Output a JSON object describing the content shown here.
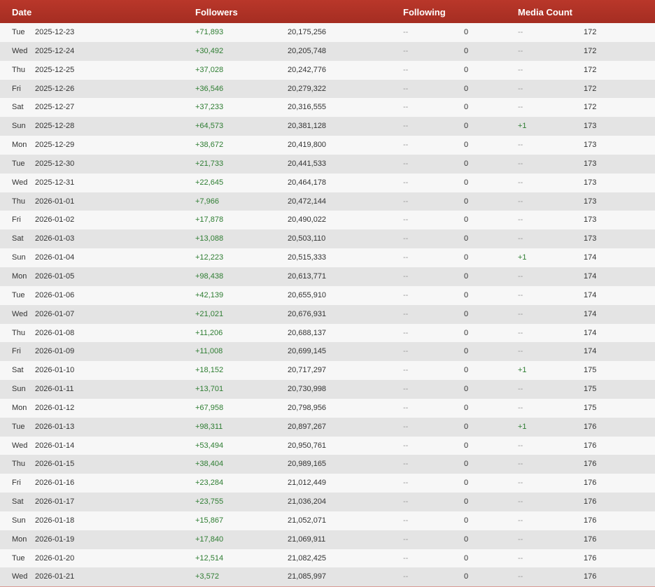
{
  "header": {
    "date": "Date",
    "followers": "Followers",
    "following": "Following",
    "media_count": "Media Count"
  },
  "colors": {
    "header_bg": "#b0321f",
    "positive": "#2e7d32",
    "neutral": "#9a9a9a"
  },
  "rows": [
    {
      "day": "Tue",
      "date": "2025-12-23",
      "followers_delta": "+71,893",
      "followers_total": "20,175,256",
      "following_delta": "--",
      "following_total": "0",
      "media_delta": "--",
      "media_total": "172"
    },
    {
      "day": "Wed",
      "date": "2025-12-24",
      "followers_delta": "+30,492",
      "followers_total": "20,205,748",
      "following_delta": "--",
      "following_total": "0",
      "media_delta": "--",
      "media_total": "172"
    },
    {
      "day": "Thu",
      "date": "2025-12-25",
      "followers_delta": "+37,028",
      "followers_total": "20,242,776",
      "following_delta": "--",
      "following_total": "0",
      "media_delta": "--",
      "media_total": "172"
    },
    {
      "day": "Fri",
      "date": "2025-12-26",
      "followers_delta": "+36,546",
      "followers_total": "20,279,322",
      "following_delta": "--",
      "following_total": "0",
      "media_delta": "--",
      "media_total": "172"
    },
    {
      "day": "Sat",
      "date": "2025-12-27",
      "followers_delta": "+37,233",
      "followers_total": "20,316,555",
      "following_delta": "--",
      "following_total": "0",
      "media_delta": "--",
      "media_total": "172"
    },
    {
      "day": "Sun",
      "date": "2025-12-28",
      "followers_delta": "+64,573",
      "followers_total": "20,381,128",
      "following_delta": "--",
      "following_total": "0",
      "media_delta": "+1",
      "media_total": "173"
    },
    {
      "day": "Mon",
      "date": "2025-12-29",
      "followers_delta": "+38,672",
      "followers_total": "20,419,800",
      "following_delta": "--",
      "following_total": "0",
      "media_delta": "--",
      "media_total": "173"
    },
    {
      "day": "Tue",
      "date": "2025-12-30",
      "followers_delta": "+21,733",
      "followers_total": "20,441,533",
      "following_delta": "--",
      "following_total": "0",
      "media_delta": "--",
      "media_total": "173"
    },
    {
      "day": "Wed",
      "date": "2025-12-31",
      "followers_delta": "+22,645",
      "followers_total": "20,464,178",
      "following_delta": "--",
      "following_total": "0",
      "media_delta": "--",
      "media_total": "173"
    },
    {
      "day": "Thu",
      "date": "2026-01-01",
      "followers_delta": "+7,966",
      "followers_total": "20,472,144",
      "following_delta": "--",
      "following_total": "0",
      "media_delta": "--",
      "media_total": "173"
    },
    {
      "day": "Fri",
      "date": "2026-01-02",
      "followers_delta": "+17,878",
      "followers_total": "20,490,022",
      "following_delta": "--",
      "following_total": "0",
      "media_delta": "--",
      "media_total": "173"
    },
    {
      "day": "Sat",
      "date": "2026-01-03",
      "followers_delta": "+13,088",
      "followers_total": "20,503,110",
      "following_delta": "--",
      "following_total": "0",
      "media_delta": "--",
      "media_total": "173"
    },
    {
      "day": "Sun",
      "date": "2026-01-04",
      "followers_delta": "+12,223",
      "followers_total": "20,515,333",
      "following_delta": "--",
      "following_total": "0",
      "media_delta": "+1",
      "media_total": "174"
    },
    {
      "day": "Mon",
      "date": "2026-01-05",
      "followers_delta": "+98,438",
      "followers_total": "20,613,771",
      "following_delta": "--",
      "following_total": "0",
      "media_delta": "--",
      "media_total": "174"
    },
    {
      "day": "Tue",
      "date": "2026-01-06",
      "followers_delta": "+42,139",
      "followers_total": "20,655,910",
      "following_delta": "--",
      "following_total": "0",
      "media_delta": "--",
      "media_total": "174"
    },
    {
      "day": "Wed",
      "date": "2026-01-07",
      "followers_delta": "+21,021",
      "followers_total": "20,676,931",
      "following_delta": "--",
      "following_total": "0",
      "media_delta": "--",
      "media_total": "174"
    },
    {
      "day": "Thu",
      "date": "2026-01-08",
      "followers_delta": "+11,206",
      "followers_total": "20,688,137",
      "following_delta": "--",
      "following_total": "0",
      "media_delta": "--",
      "media_total": "174"
    },
    {
      "day": "Fri",
      "date": "2026-01-09",
      "followers_delta": "+11,008",
      "followers_total": "20,699,145",
      "following_delta": "--",
      "following_total": "0",
      "media_delta": "--",
      "media_total": "174"
    },
    {
      "day": "Sat",
      "date": "2026-01-10",
      "followers_delta": "+18,152",
      "followers_total": "20,717,297",
      "following_delta": "--",
      "following_total": "0",
      "media_delta": "+1",
      "media_total": "175"
    },
    {
      "day": "Sun",
      "date": "2026-01-11",
      "followers_delta": "+13,701",
      "followers_total": "20,730,998",
      "following_delta": "--",
      "following_total": "0",
      "media_delta": "--",
      "media_total": "175"
    },
    {
      "day": "Mon",
      "date": "2026-01-12",
      "followers_delta": "+67,958",
      "followers_total": "20,798,956",
      "following_delta": "--",
      "following_total": "0",
      "media_delta": "--",
      "media_total": "175"
    },
    {
      "day": "Tue",
      "date": "2026-01-13",
      "followers_delta": "+98,311",
      "followers_total": "20,897,267",
      "following_delta": "--",
      "following_total": "0",
      "media_delta": "+1",
      "media_total": "176"
    },
    {
      "day": "Wed",
      "date": "2026-01-14",
      "followers_delta": "+53,494",
      "followers_total": "20,950,761",
      "following_delta": "--",
      "following_total": "0",
      "media_delta": "--",
      "media_total": "176"
    },
    {
      "day": "Thu",
      "date": "2026-01-15",
      "followers_delta": "+38,404",
      "followers_total": "20,989,165",
      "following_delta": "--",
      "following_total": "0",
      "media_delta": "--",
      "media_total": "176"
    },
    {
      "day": "Fri",
      "date": "2026-01-16",
      "followers_delta": "+23,284",
      "followers_total": "21,012,449",
      "following_delta": "--",
      "following_total": "0",
      "media_delta": "--",
      "media_total": "176"
    },
    {
      "day": "Sat",
      "date": "2026-01-17",
      "followers_delta": "+23,755",
      "followers_total": "21,036,204",
      "following_delta": "--",
      "following_total": "0",
      "media_delta": "--",
      "media_total": "176"
    },
    {
      "day": "Sun",
      "date": "2026-01-18",
      "followers_delta": "+15,867",
      "followers_total": "21,052,071",
      "following_delta": "--",
      "following_total": "0",
      "media_delta": "--",
      "media_total": "176"
    },
    {
      "day": "Mon",
      "date": "2026-01-19",
      "followers_delta": "+17,840",
      "followers_total": "21,069,911",
      "following_delta": "--",
      "following_total": "0",
      "media_delta": "--",
      "media_total": "176"
    },
    {
      "day": "Tue",
      "date": "2026-01-20",
      "followers_delta": "+12,514",
      "followers_total": "21,082,425",
      "following_delta": "--",
      "following_total": "0",
      "media_delta": "--",
      "media_total": "176"
    },
    {
      "day": "Wed",
      "date": "2026-01-21",
      "followers_delta": "+3,572",
      "followers_total": "21,085,997",
      "following_delta": "--",
      "following_total": "0",
      "media_delta": "--",
      "media_total": "176"
    }
  ]
}
